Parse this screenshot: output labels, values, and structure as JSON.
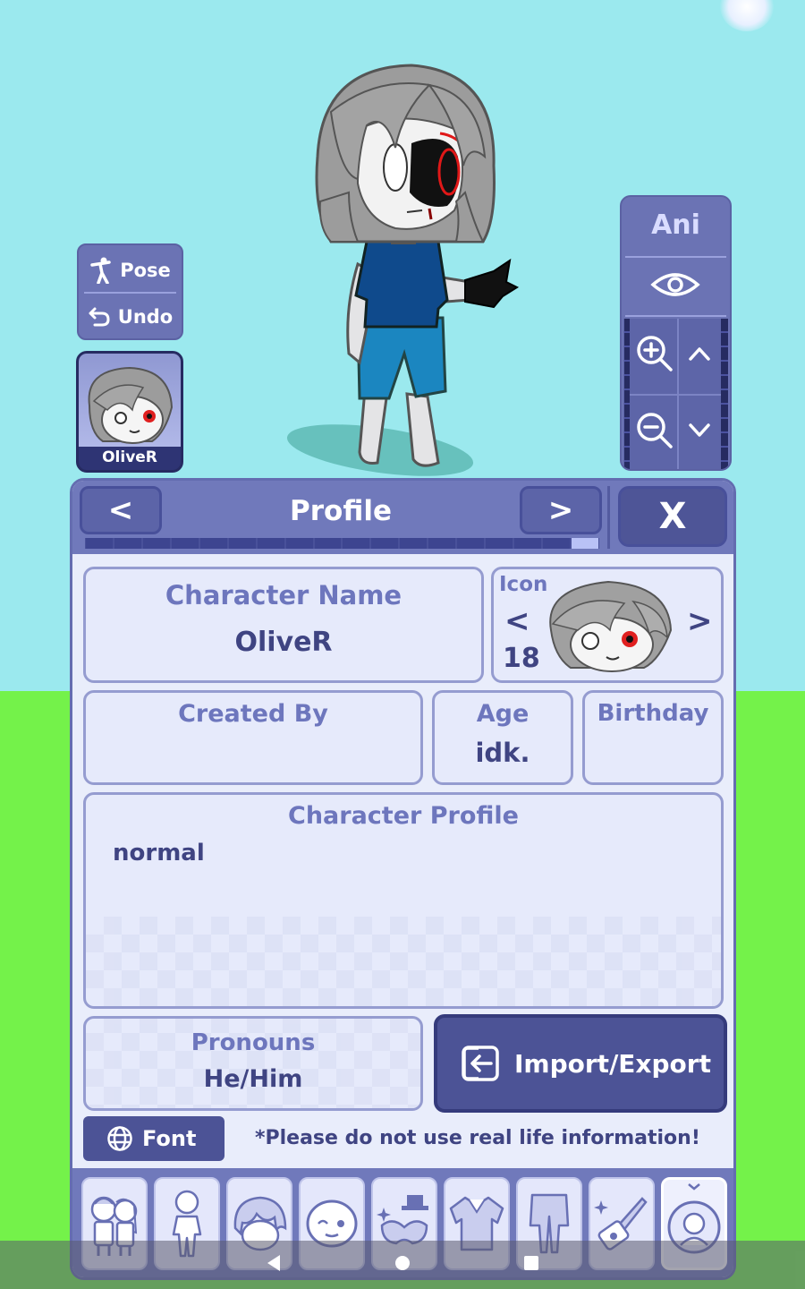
{
  "scene": {
    "sky_color": "#9be9ee",
    "ground_color": "#74f24a"
  },
  "pose_panel": {
    "pose_label": "Pose",
    "undo_label": "Undo"
  },
  "avatar": {
    "name": "OliveR"
  },
  "ani_panel": {
    "label": "Ani",
    "icons": [
      "eye-icon",
      "zoom-in-icon",
      "zoom-out-icon",
      "arrow-up-icon",
      "arrow-down-icon"
    ]
  },
  "dialog": {
    "title": "Profile",
    "prev_label": "<",
    "next_label": ">",
    "close_label": "X",
    "progress": {
      "segments": 18,
      "filled": 1
    }
  },
  "profile": {
    "character_name_label": "Character Name",
    "character_name": "OliveR",
    "icon_label": "Icon",
    "icon_number": "18",
    "icon_prev": "<",
    "icon_next": ">",
    "created_by_label": "Created By",
    "created_by": "",
    "age_label": "Age",
    "age": "idk.",
    "birthday_label": "Birthday",
    "birthday": "",
    "character_profile_label": "Character Profile",
    "character_profile": "normal",
    "pronouns_label": "Pronouns",
    "pronouns": "He/Him"
  },
  "actions": {
    "import_export_label": "Import/Export",
    "font_label": "Font",
    "warning": "*Please do not use real life information!"
  },
  "toolbar": {
    "items": [
      "group-icon",
      "body-icon",
      "hair-icon",
      "face-icon",
      "accessory-icon",
      "top-icon",
      "bottom-icon",
      "item-icon",
      "profile-icon"
    ],
    "active": "profile-icon"
  },
  "accent_colors": {
    "panel": "#7079bb",
    "button_dark": "#4c5396",
    "label": "#6d76bd",
    "text": "#3f4482"
  }
}
